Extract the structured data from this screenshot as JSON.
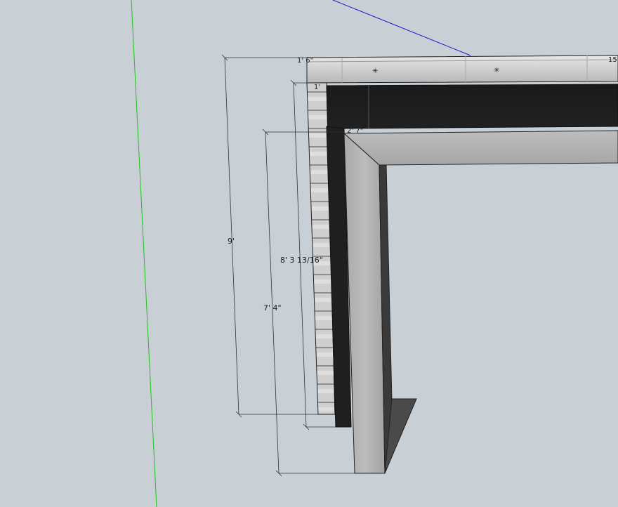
{
  "scene": {
    "background_color": "#c8d0d6",
    "axis_colors": {
      "green_axis": "#22c022",
      "blue_axis": "#1a1acc"
    }
  },
  "dimensions": {
    "overall_height": "9'",
    "inner_height": "8' 3 13/16\"",
    "door_height": "7' 4\"",
    "top_depth": "1' 6\"",
    "header_offset": "1'",
    "gap_label": "2' 7\"",
    "right_edge_label": "15"
  }
}
